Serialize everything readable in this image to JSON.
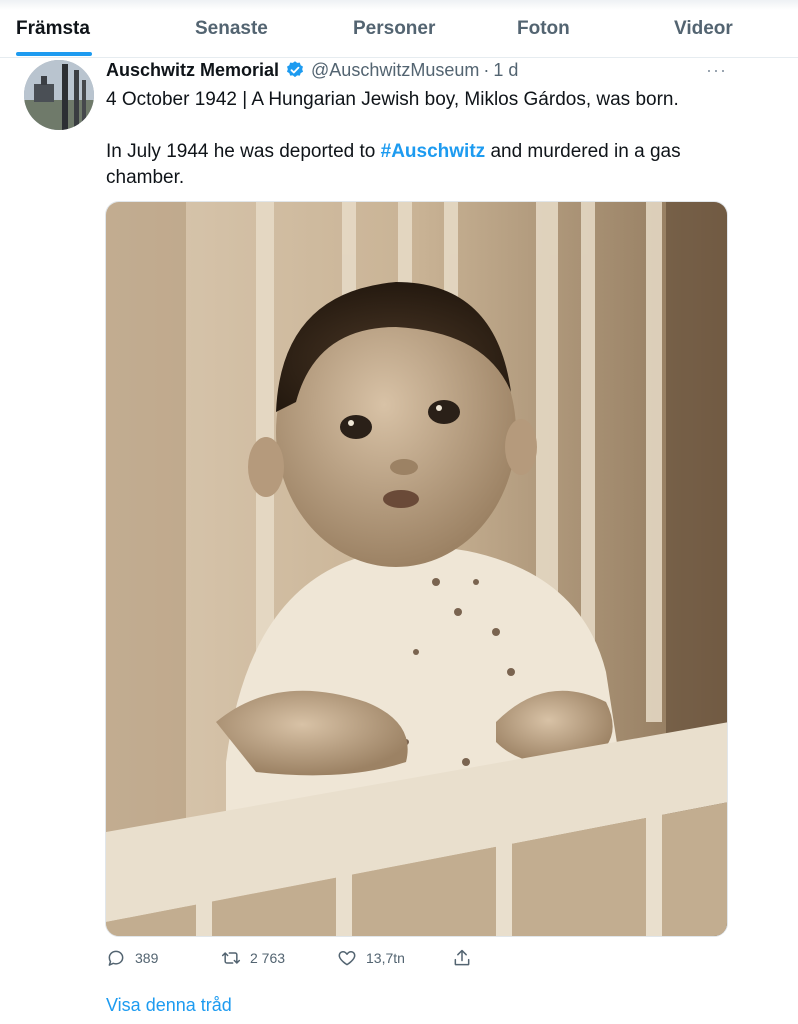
{
  "tabs": [
    {
      "label": "Främsta",
      "active": true
    },
    {
      "label": "Senaste",
      "active": false
    },
    {
      "label": "Personer",
      "active": false
    },
    {
      "label": "Foton",
      "active": false
    },
    {
      "label": "Videor",
      "active": false
    }
  ],
  "tweet": {
    "author": "Auschwitz Memorial",
    "handle": "@AuschwitzMuseum",
    "separator": "·",
    "time": "1 d",
    "line1": "4 October 1942 | A Hungarian Jewish boy, Miklos Gárdos, was born.",
    "line2_before": "In July 1944 he was deported to ",
    "hashtag": "#Auschwitz",
    "line2_after": " and murdered in a gas chamber.",
    "more": "···"
  },
  "actions": {
    "replies": "389",
    "retweets": "2 763",
    "likes": "13,7tn"
  },
  "show_thread": "Visa denna tråd",
  "icons": {
    "verified": "verified-badge-icon",
    "reply": "reply-icon",
    "retweet": "retweet-icon",
    "like": "heart-icon",
    "share": "share-icon",
    "more": "more-icon"
  },
  "colors": {
    "accent": "#1d9bf0",
    "secondary_text": "#536471",
    "primary_text": "#0f1419"
  }
}
